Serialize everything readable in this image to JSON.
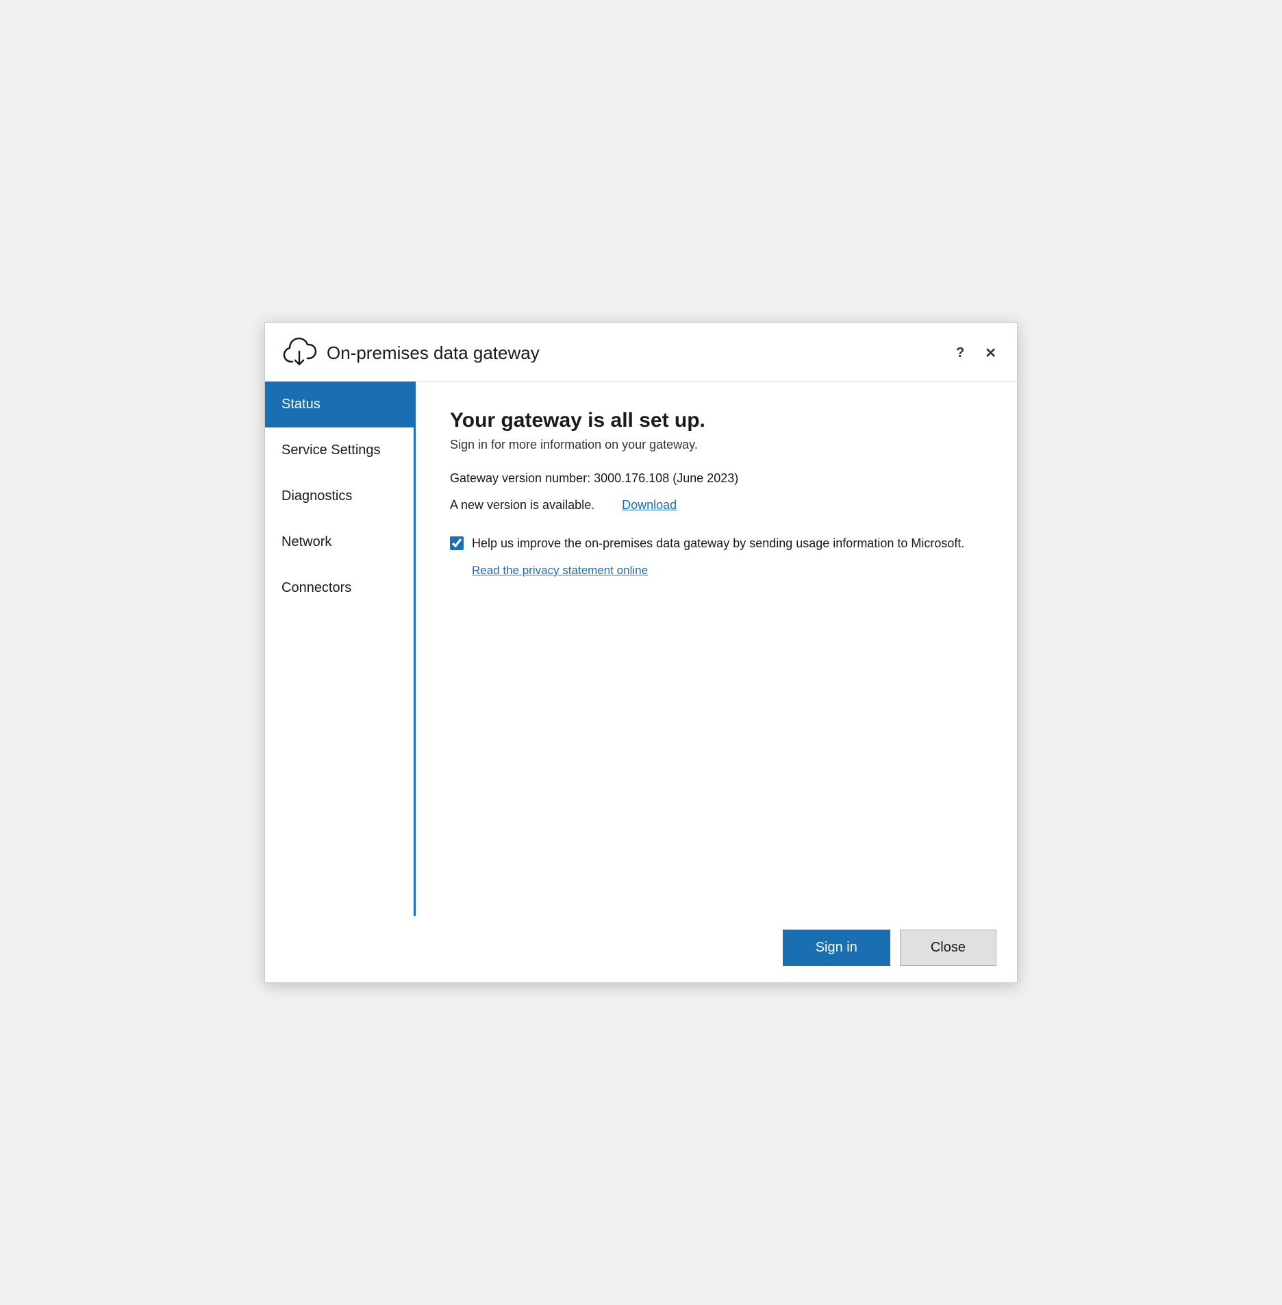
{
  "window": {
    "title": "On-premises data gateway",
    "controls": {
      "help": "?",
      "close": "✕"
    }
  },
  "sidebar": {
    "items": [
      {
        "id": "status",
        "label": "Status",
        "active": true
      },
      {
        "id": "service-settings",
        "label": "Service Settings",
        "active": false
      },
      {
        "id": "diagnostics",
        "label": "Diagnostics",
        "active": false
      },
      {
        "id": "network",
        "label": "Network",
        "active": false
      },
      {
        "id": "connectors",
        "label": "Connectors",
        "active": false
      }
    ]
  },
  "main": {
    "heading": "Your gateway is all set up.",
    "subtext": "Sign in for more information on your gateway.",
    "version_info": "Gateway version number: 3000.176.108 (June 2023)",
    "update_text": "A new version is available.",
    "download_label": "Download",
    "checkbox_label": "Help us improve the on-premises data gateway by sending usage information to Microsoft.",
    "privacy_link_label": "Read the privacy statement online",
    "checkbox_checked": true
  },
  "footer": {
    "signin_label": "Sign in",
    "close_label": "Close"
  }
}
